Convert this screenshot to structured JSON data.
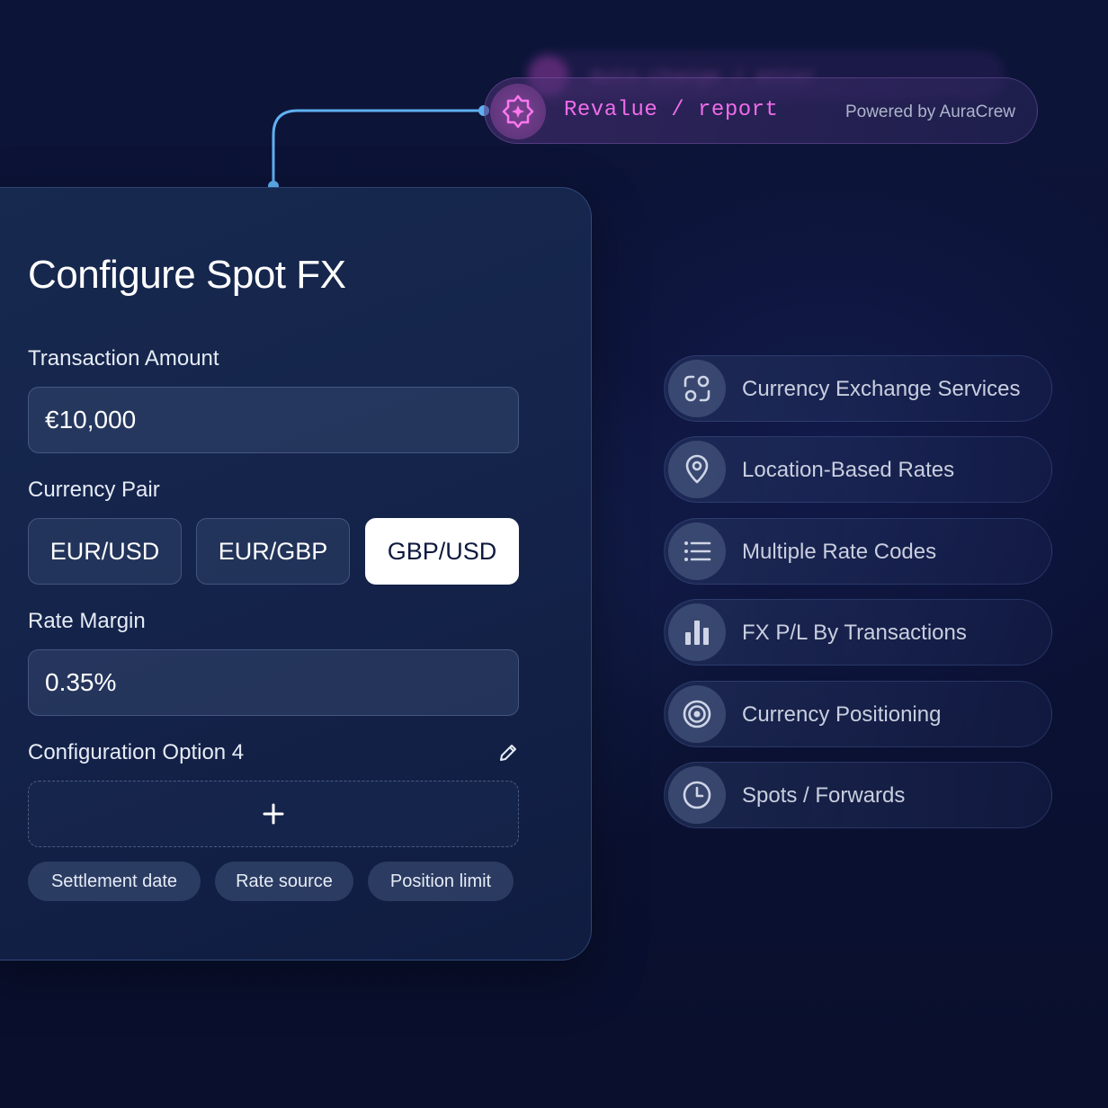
{
  "agent": {
    "ghost_label": "Auto-change / enter",
    "label": "Revalue / report",
    "powered_by": "Powered by AuraCrew",
    "icon": "sparkle-icon"
  },
  "card": {
    "title": "Configure Spot FX",
    "amount_label": "Transaction Amount",
    "amount_value": "€10,000",
    "pair_label": "Currency Pair",
    "pairs": [
      {
        "label": "EUR/USD",
        "selected": false
      },
      {
        "label": "EUR/GBP",
        "selected": false
      },
      {
        "label": "GBP/USD",
        "selected": true
      }
    ],
    "margin_label": "Rate Margin",
    "margin_value": "0.35%",
    "option_label": "Configuration Option 4",
    "add_symbol": "+",
    "chips": [
      "Settlement date",
      "Rate source",
      "Position limit"
    ]
  },
  "features": [
    {
      "label": "Currency Exchange Services",
      "icon": "exchange-icon"
    },
    {
      "label": "Location-Based Rates",
      "icon": "location-pin-icon"
    },
    {
      "label": "Multiple Rate Codes",
      "icon": "list-icon"
    },
    {
      "label": "FX P/L By Transactions",
      "icon": "bar-chart-icon"
    },
    {
      "label": "Currency Positioning",
      "icon": "target-icon"
    },
    {
      "label": "Spots / Forwards",
      "icon": "clock-icon"
    }
  ],
  "colors": {
    "accent_magenta": "#ee6ce9",
    "connector_blue": "#5fb0f2",
    "background": "#0b1236"
  }
}
